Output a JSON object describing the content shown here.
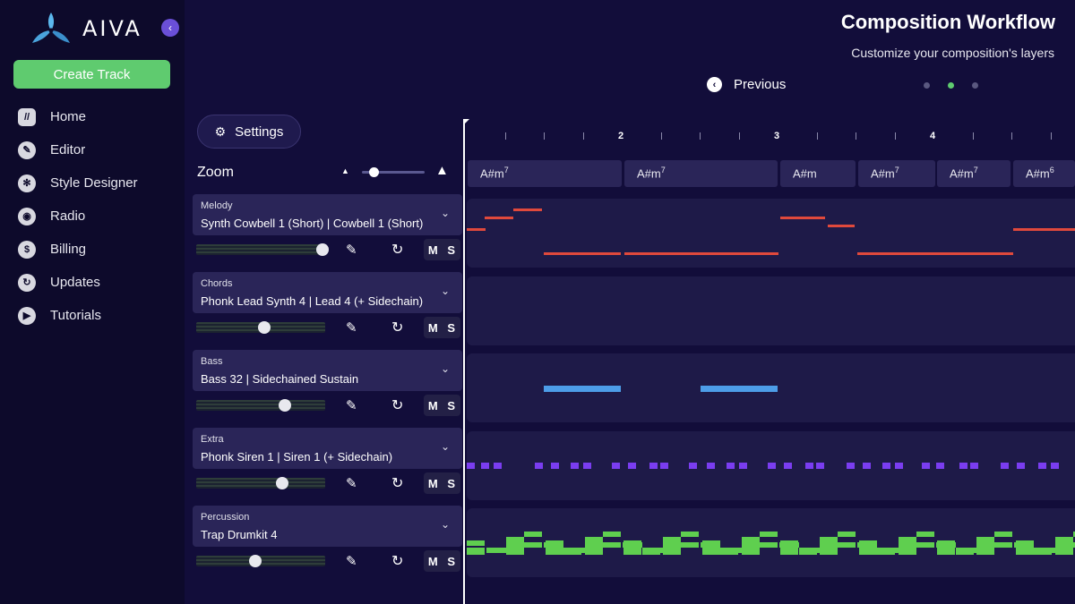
{
  "brand": {
    "name": "AIVA"
  },
  "sidebar": {
    "create_label": "Create Track",
    "items": [
      {
        "label": "Home",
        "icon": "home-icon"
      },
      {
        "label": "Editor",
        "icon": "pencil-icon"
      },
      {
        "label": "Style Designer",
        "icon": "fan-icon"
      },
      {
        "label": "Radio",
        "icon": "radio-icon"
      },
      {
        "label": "Billing",
        "icon": "dollar-icon"
      },
      {
        "label": "Updates",
        "icon": "refresh-icon"
      },
      {
        "label": "Tutorials",
        "icon": "play-icon"
      }
    ]
  },
  "header": {
    "title": "Composition Workflow",
    "subtitle": "Customize your composition's layers",
    "previous_label": "Previous"
  },
  "controls": {
    "settings_label": "Settings",
    "zoom_label": "Zoom",
    "zoom_level": 0.18
  },
  "tracks": [
    {
      "category": "Melody",
      "instrument": "Synth Cowbell 1 (Short) | Cowbell 1 (Short)",
      "volume": 0.98,
      "mute": "M",
      "solo": "S",
      "color": "#e0493c"
    },
    {
      "category": "Chords",
      "instrument": "Phonk Lead Synth 4 | Lead 4 (+ Sidechain)",
      "volume": 0.53,
      "mute": "M",
      "solo": "S",
      "color": "#f0d860"
    },
    {
      "category": "Bass",
      "instrument": "Bass 32 | Sidechained Sustain",
      "volume": 0.69,
      "mute": "M",
      "solo": "S",
      "color": "#4d9de8"
    },
    {
      "category": "Extra",
      "instrument": "Phonk Siren 1 | Siren 1 (+ Sidechain)",
      "volume": 0.67,
      "mute": "M",
      "solo": "S",
      "color": "#7a3df0"
    },
    {
      "category": "Percussion",
      "instrument": "Trap Drumkit 4",
      "volume": 0.46,
      "mute": "M",
      "solo": "S",
      "color": "#5fcf4f"
    }
  ],
  "timeline": {
    "bar_numbers": [
      "2",
      "3",
      "4"
    ],
    "chords": [
      {
        "root": "A#m",
        "ext": "7"
      },
      {
        "root": "A#m",
        "ext": "7"
      },
      {
        "root": "A#m",
        "ext": ""
      },
      {
        "root": "A#m",
        "ext": "7"
      },
      {
        "root": "A#m",
        "ext": "7"
      },
      {
        "root": "A#m",
        "ext": "6"
      }
    ]
  }
}
